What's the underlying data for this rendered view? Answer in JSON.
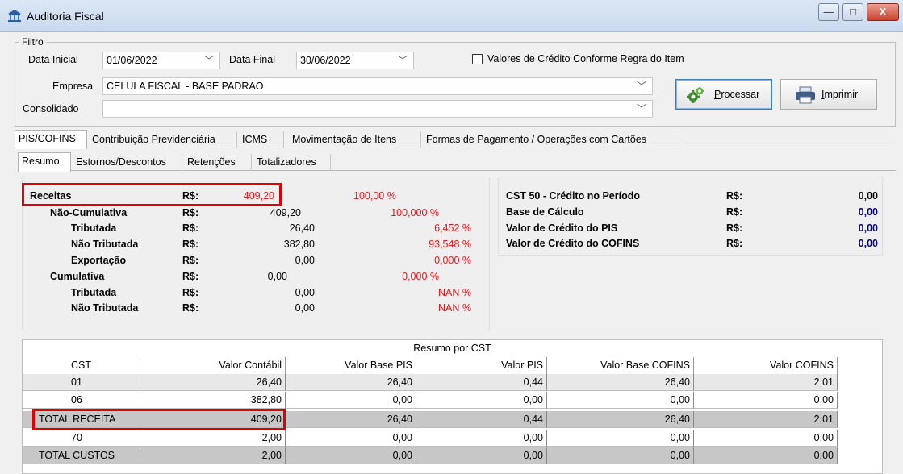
{
  "window": {
    "title": "Auditoria Fiscal",
    "minimize": "—",
    "maximize": "□",
    "close": "X"
  },
  "filter": {
    "legend": "Filtro",
    "data_inicial_label": "Data Inicial",
    "data_inicial_value": "01/06/2022",
    "data_final_label": "Data Final",
    "data_final_value": "30/06/2022",
    "checkbox_label": "Valores de Crédito Conforme Regra do Item",
    "empresa_label": "Empresa",
    "empresa_value": "CELULA FISCAL - BASE PADRAO",
    "consolidado_label": "Consolidado",
    "consolidado_value": "",
    "processar_pre": "",
    "processar_u": "P",
    "processar_post": "rocessar",
    "imprimir_u": "I",
    "imprimir_post": "mprimir"
  },
  "tabs": [
    "PIS/COFINS",
    "Contribuição Previdenciária",
    "ICMS",
    "Movimentação de Itens",
    "Formas de Pagamento / Operações com Cartões"
  ],
  "subtabs": [
    "Resumo",
    "Estornos/Descontos",
    "Retenções",
    "Totalizadores"
  ],
  "summary": {
    "rs": "R$:",
    "receitas": {
      "label": "Receitas",
      "value": "409,20",
      "pct": "100,00 %"
    },
    "nao_cumulativa": {
      "label": "Não-Cumulativa",
      "value": "409,20",
      "pct": "100,000 %"
    },
    "nc_tributada": {
      "label": "Tributada",
      "value": "26,40",
      "pct": "6,452 %"
    },
    "nc_nao_tributada": {
      "label": "Não Tributada",
      "value": "382,80",
      "pct": "93,548 %"
    },
    "nc_exportacao": {
      "label": "Exportação",
      "value": "0,00",
      "pct": "0,000 %"
    },
    "cumulativa": {
      "label": "Cumulativa",
      "value": "0,00",
      "pct": "0,000 %"
    },
    "c_tributada": {
      "label": "Tributada",
      "value": "0,00",
      "pct": "NAN %"
    },
    "c_nao_tributada": {
      "label": "Não Tributada",
      "value": "0,00",
      "pct": "NAN %"
    }
  },
  "credit": {
    "rs": "R$:",
    "cst50": {
      "label": "CST 50 - Crédito no Período",
      "value": "0,00"
    },
    "base": {
      "label": "Base de Cálculo",
      "value": "0,00"
    },
    "pis": {
      "label": "Valor de Crédito do PIS",
      "value": "0,00"
    },
    "cofins": {
      "label": "Valor de Crédito do COFINS",
      "value": "0,00"
    }
  },
  "grid": {
    "title": "Resumo por CST",
    "headers": [
      "CST",
      "Valor Contábil",
      "Valor Base PIS",
      "Valor PIS",
      "Valor Base COFINS",
      "Valor COFINS"
    ],
    "rows": [
      [
        "01",
        "26,40",
        "26,40",
        "0,44",
        "26,40",
        "2,01"
      ],
      [
        "06",
        "382,80",
        "0,00",
        "0,00",
        "0,00",
        "0,00"
      ],
      [
        "TOTAL RECEITA",
        "409,20",
        "26,40",
        "0,44",
        "26,40",
        "2,01"
      ],
      [
        "70",
        "2,00",
        "0,00",
        "0,00",
        "0,00",
        "0,00"
      ],
      [
        "TOTAL CUSTOS",
        "2,00",
        "0,00",
        "0,00",
        "0,00",
        "0,00"
      ]
    ]
  },
  "colors": {
    "red": "#e8141b",
    "blue": "#000080",
    "highlight": "#e20000"
  }
}
